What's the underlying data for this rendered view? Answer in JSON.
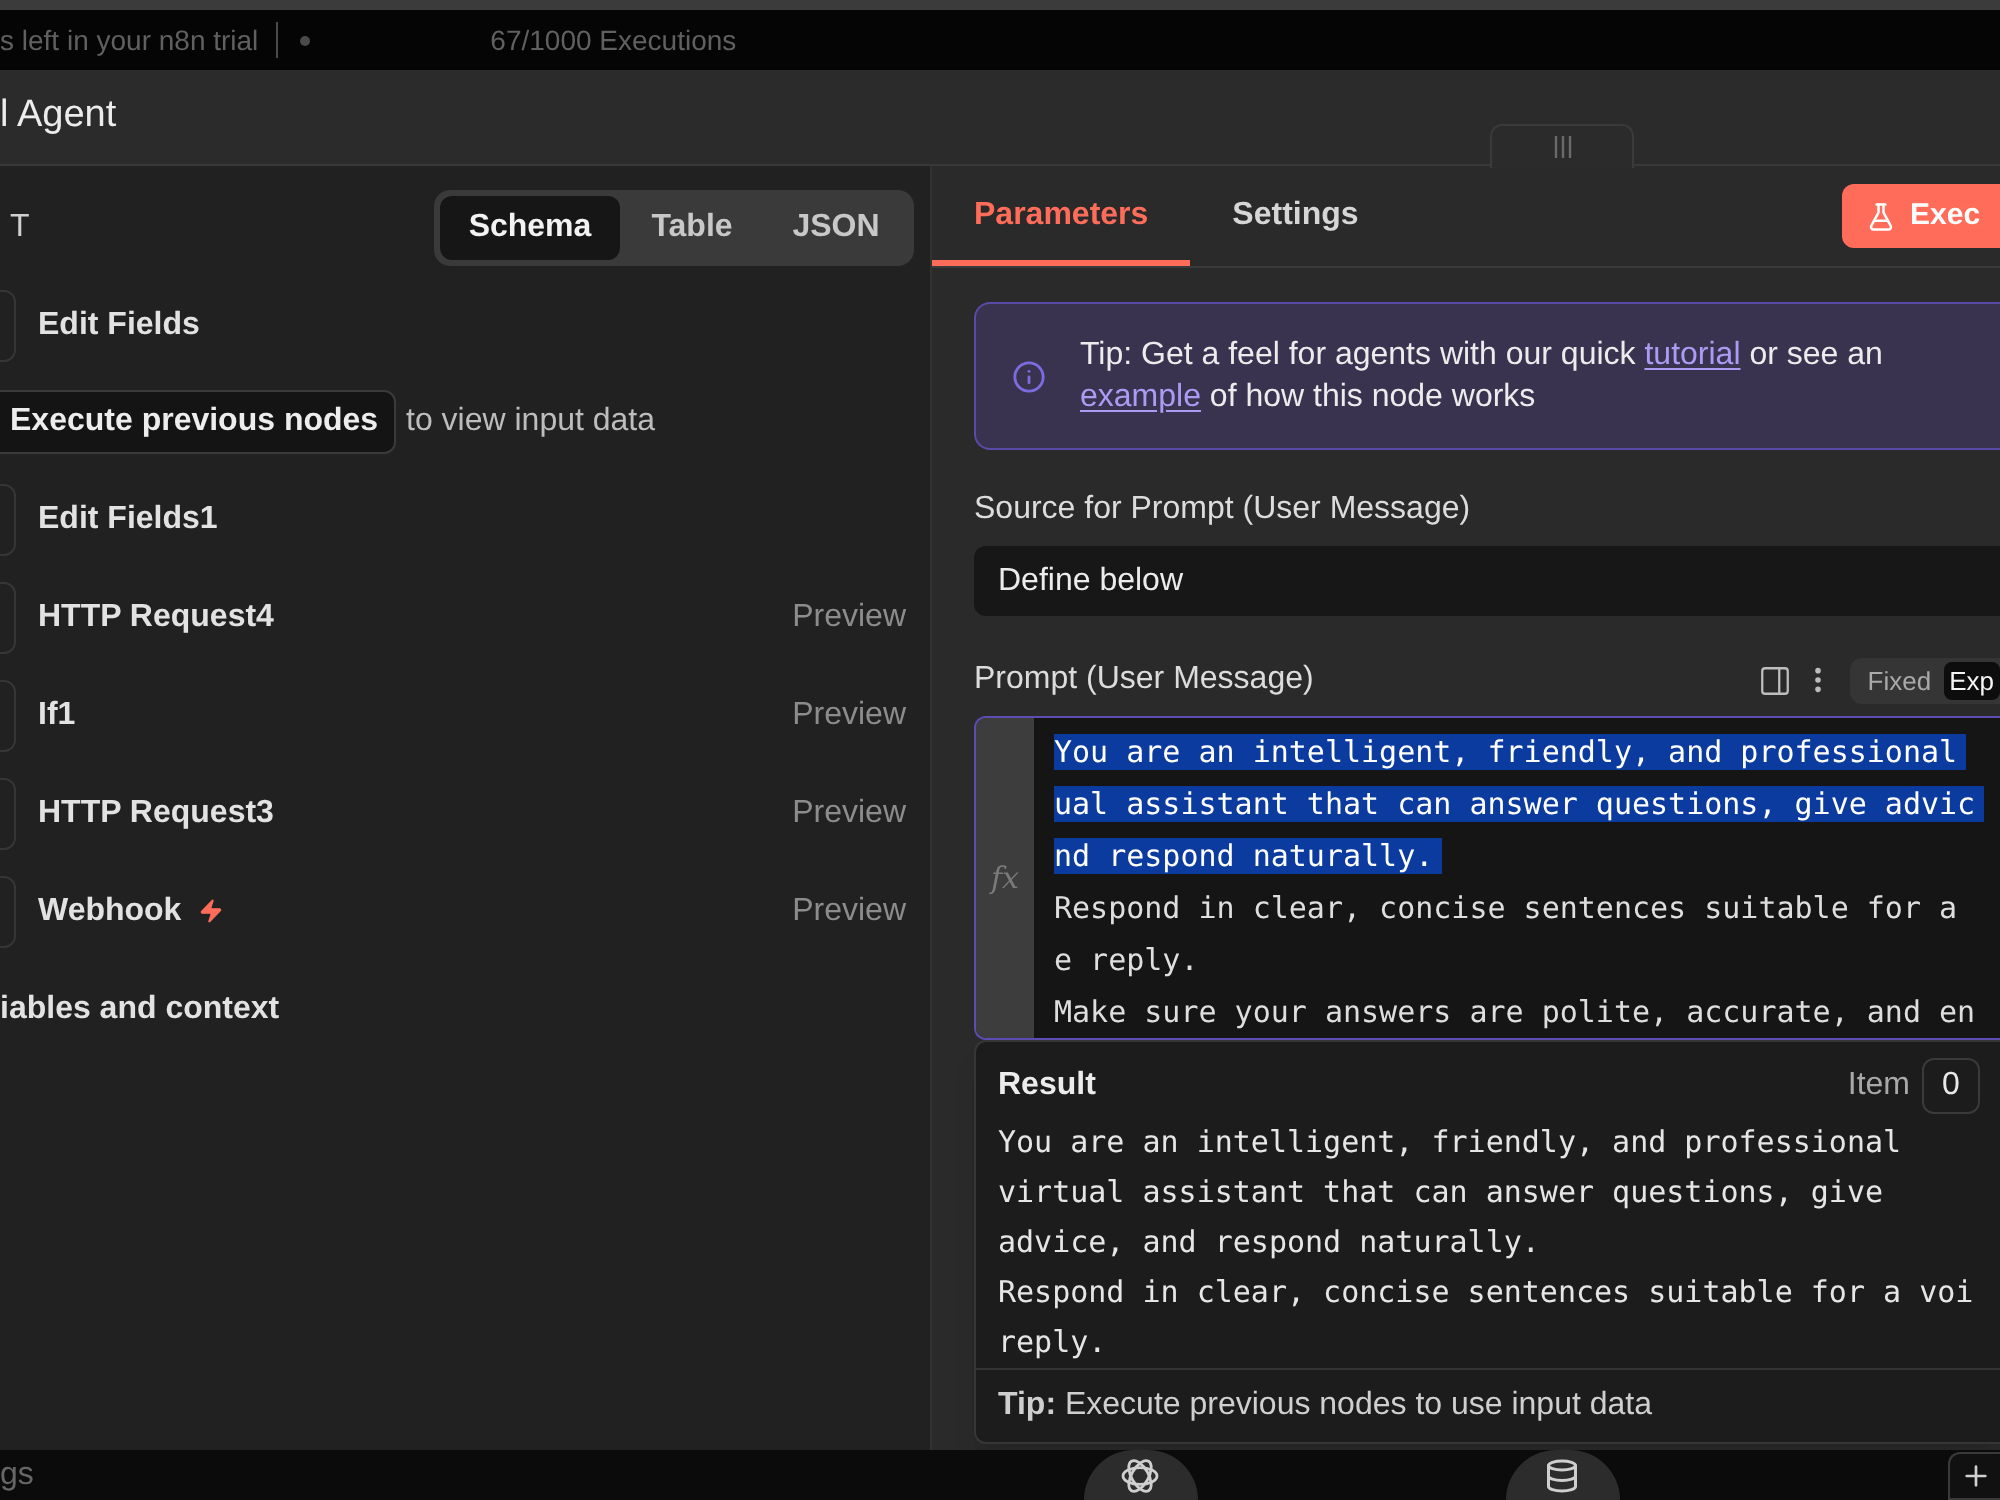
{
  "trial_banner": {
    "trial_text": "s left in your n8n trial",
    "executions": "67/1000 Executions"
  },
  "modal": {
    "title": "l Agent"
  },
  "input_panel": {
    "heading": "T",
    "view_tabs": [
      {
        "label": "Schema",
        "selected": true
      },
      {
        "label": "Table",
        "selected": false
      },
      {
        "label": "JSON",
        "selected": false
      }
    ],
    "rows": [
      {
        "kind": "node",
        "name": "Edit Fields",
        "trigger": false
      },
      {
        "kind": "hint",
        "button": "Execute previous nodes",
        "text": "to view input data"
      },
      {
        "kind": "node",
        "name": "Edit Fields1",
        "trigger": false
      },
      {
        "kind": "node",
        "name": "HTTP Request4",
        "trigger": false,
        "action": "Preview"
      },
      {
        "kind": "node",
        "name": "If1",
        "trigger": false,
        "action": "Preview"
      },
      {
        "kind": "node",
        "name": "HTTP Request3",
        "trigger": false,
        "action": "Preview"
      },
      {
        "kind": "node",
        "name": "Webhook",
        "trigger": true,
        "action": "Preview"
      }
    ],
    "variables_section": "iables and context"
  },
  "parameters_panel": {
    "tabs": [
      {
        "label": "Parameters",
        "selected": true
      },
      {
        "label": "Settings",
        "selected": false
      }
    ],
    "execute_button": "Exec",
    "tip": {
      "lines": [
        [
          {
            "kind": "text",
            "text": "Tip: Get a feel for agents with our quick "
          },
          {
            "kind": "link",
            "text": "tutorial"
          },
          {
            "kind": "text",
            "text": " or see an"
          }
        ],
        [
          {
            "kind": "link",
            "text": "example"
          },
          {
            "kind": "text",
            "text": " of how this node works"
          }
        ]
      ]
    },
    "source_field": {
      "label": "Source for Prompt (User Message)",
      "value": "Define below"
    },
    "prompt_field": {
      "label": "Prompt (User Message)",
      "mode_tabs": [
        {
          "label": "Fixed",
          "selected": false
        },
        {
          "label": "Exp",
          "selected": true
        }
      ],
      "gutter_label": "fx",
      "lines": [
        {
          "text": "You are an intelligent, friendly, and professional",
          "selected": true
        },
        {
          "text": "ual assistant that can answer questions, give advic",
          "selected": true
        },
        {
          "text": "nd respond naturally.",
          "selected": true
        },
        {
          "text": "Respond in clear, concise sentences suitable for a",
          "selected": false
        },
        {
          "text": "e reply.",
          "selected": false
        },
        {
          "text": "Make sure your answers are polite, accurate, and en",
          "selected": false
        }
      ]
    },
    "result": {
      "title": "Result",
      "item_label": "Item",
      "item_value": "0",
      "lines": [
        "You are an intelligent, friendly, and professional",
        "virtual assistant that can answer questions, give",
        "advice, and respond naturally.",
        "Respond in clear, concise sentences suitable for a voi",
        "reply."
      ],
      "tip": "**Tip:** Execute previous nodes to use input data"
    }
  },
  "bottom_bar": {
    "left_text": "gs"
  }
}
